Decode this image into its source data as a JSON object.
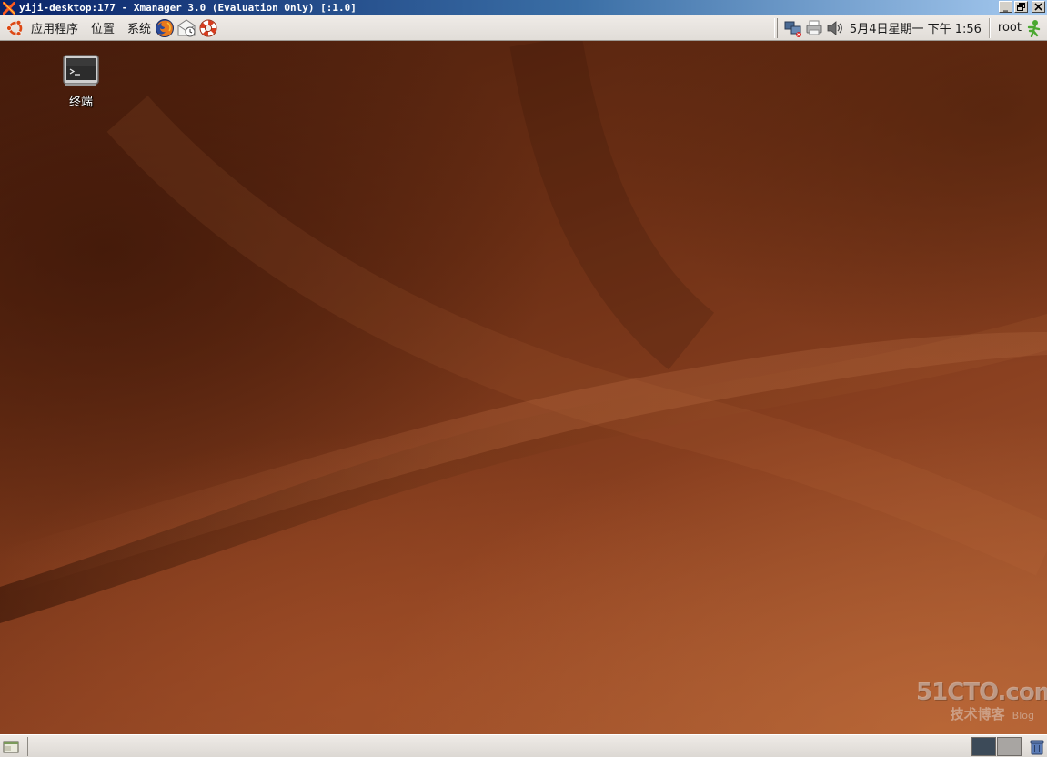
{
  "xmanager_window": {
    "title": "yiji-desktop:177 - Xmanager 3.0 (Evaluation Only) [:1.0]",
    "logo_icon": "xmanager-x-icon",
    "controls": {
      "minimize": "_",
      "restore": "❐",
      "close": "✕"
    }
  },
  "top_panel": {
    "menus": [
      {
        "label": "应用程序",
        "icon": "ubuntu-logo-icon"
      },
      {
        "label": "位置"
      },
      {
        "label": "系统"
      }
    ],
    "launchers": [
      "firefox-icon",
      "mail-icon",
      "help-lifebuoy-icon"
    ],
    "tray_icons": [
      "network-icon",
      "printer-icon",
      "volume-icon"
    ],
    "clock": "5月4日星期一 下午 1:56",
    "user": "root",
    "user_icon": "fast-user-switch-icon"
  },
  "desktop": {
    "icons": [
      {
        "label": "终端",
        "icon": "terminal-icon"
      }
    ],
    "watermark": {
      "main": "51CTO.com",
      "sub": "技术博客",
      "blog": "Blog"
    }
  },
  "bottom_panel": {
    "show_desktop_icon": "show-desktop-icon",
    "workspaces": [
      {
        "state": "active"
      },
      {
        "state": "inactive"
      }
    ],
    "trash_icon": "trash-icon"
  },
  "colors": {
    "title_bar_start": "#0a246a",
    "panel_bg": "#e6e2dd",
    "desktop_dark": "#4a1e0c",
    "desktop_light": "#a55a32"
  }
}
